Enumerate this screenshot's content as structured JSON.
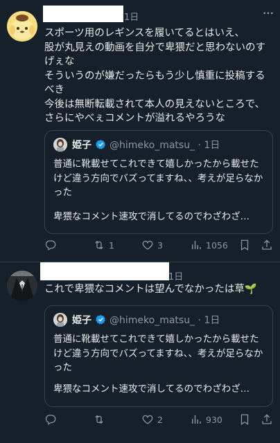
{
  "posts": [
    {
      "time": "1日",
      "text": "スポーツ用のレギンスを履いてるとはいえ、\n股が丸見えの動画を自分で卑猥だと思わないのすげぇな\nそういうのが嫌だったらもう少し慎重に投稿するべき\n今後は無断転載されて本人の見えないところで、さらにやべぇコメントが溢れるやろうな",
      "quote": {
        "name": "姫子",
        "handle": "@himeko_matsu_",
        "time": "· 1日",
        "text1": "普通に靴載せてこれできて嬉しかったから載せたけど違う方向でバズってますね、、考えが足らなかった",
        "text2": "卑猥なコメント速攻で消してるのでわざわざ…"
      },
      "actions": {
        "replies": "",
        "reposts": "1",
        "likes": "3",
        "views": "1056"
      }
    },
    {
      "time": "1日",
      "text": "これで卑猥なコメントは望んでなかったは草🌱",
      "quote": {
        "name": "姫子",
        "handle": "@himeko_matsu_",
        "time": "· 1日",
        "text1": "普通に靴載せてこれできて嬉しかったから載せたけど違う方向でバズってますね、、考えが足らなかった",
        "text2": "卑猥なコメント速攻で消してるのでわざわざ…"
      },
      "actions": {
        "replies": "",
        "reposts": "",
        "likes": "2",
        "views": "930"
      }
    }
  ],
  "icons": {
    "more": "more-icon",
    "reply": "reply-icon",
    "repost": "repost-icon",
    "like": "like-icon",
    "views": "views-icon",
    "bookmark": "bookmark-icon",
    "share": "share-icon",
    "verified": "verified-badge-icon"
  },
  "colors": {
    "background": "#15202b",
    "text": "#e7e9ea",
    "muted": "#8b98a5",
    "border": "#38444d",
    "verified": "#1d9bf0"
  }
}
